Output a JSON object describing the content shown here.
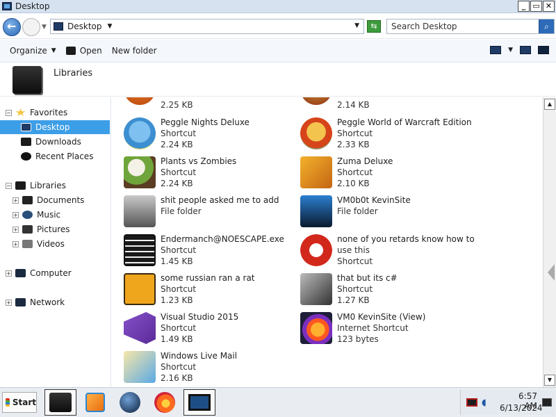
{
  "window": {
    "title": "Desktop",
    "controls": {
      "minimize": "_",
      "restore": "▭",
      "close": "✕"
    }
  },
  "address_bar": {
    "path": "Desktop",
    "search_placeholder": "Search Desktop"
  },
  "toolbar": {
    "organize_label": "Organize",
    "open_label": "Open",
    "new_folder_label": "New folder"
  },
  "details_header": {
    "label": "Libraries"
  },
  "sidebar": {
    "favorites": "Favorites",
    "desktop": "Desktop",
    "downloads": "Downloads",
    "recent_places": "Recent Places",
    "libraries": "Libraries",
    "documents": "Documents",
    "music": "Music",
    "pictures": "Pictures",
    "videos": "Videos",
    "computer": "Computer",
    "network": "Network"
  },
  "files": {
    "top_left_size": "2.25 KB",
    "top_right_size": "2.14 KB",
    "items": [
      {
        "name": "Peggle Nights Deluxe",
        "type": "Shortcut",
        "size": "2.24 KB",
        "icon": "peggle-nights-icon"
      },
      {
        "name": "Peggle World of Warcraft Edition",
        "type": "Shortcut",
        "size": "2.33 KB",
        "icon": "peggle-wow-icon"
      },
      {
        "name": "Plants vs Zombies",
        "type": "Shortcut",
        "size": "2.24 KB",
        "icon": "plants-vs-zombies-icon"
      },
      {
        "name": "Zuma Deluxe",
        "type": "Shortcut",
        "size": "2.10 KB",
        "icon": "zuma-deluxe-icon"
      },
      {
        "name": "shit people asked me to add",
        "type": "File folder",
        "size": "",
        "icon": "folder-icon"
      },
      {
        "name": "VM0b0t KevinSite",
        "type": "File folder",
        "size": "",
        "icon": "folder-icon"
      },
      {
        "name": "Endermanch@NOESCAPE.exe",
        "type": "Shortcut",
        "size": "1.45 KB",
        "icon": "exe-icon"
      },
      {
        "name": "none of you retards know how to",
        "name2": "use this",
        "type": "Shortcut",
        "size": "",
        "icon": "red-dragon-icon"
      },
      {
        "name": "some russian ran a rat",
        "type": "Shortcut",
        "size": "1.23 KB",
        "icon": "de-icon"
      },
      {
        "name": "that but its c#",
        "type": "Shortcut",
        "size": "1.27 KB",
        "icon": "stacked-windows-icon"
      },
      {
        "name": "Visual Studio 2015",
        "type": "Shortcut",
        "size": "1.49 KB",
        "icon": "visual-studio-icon"
      },
      {
        "name": "VM0 KevinSite (View)",
        "type": "Internet Shortcut",
        "size": "123 bytes",
        "icon": "firefox-icon"
      },
      {
        "name": "Windows Live Mail",
        "type": "Shortcut",
        "size": "2.16 KB",
        "icon": "windows-live-mail-icon"
      }
    ]
  },
  "taskbar": {
    "start_label": "Start",
    "time": "6:57 AM",
    "date": "6/13/2024"
  }
}
